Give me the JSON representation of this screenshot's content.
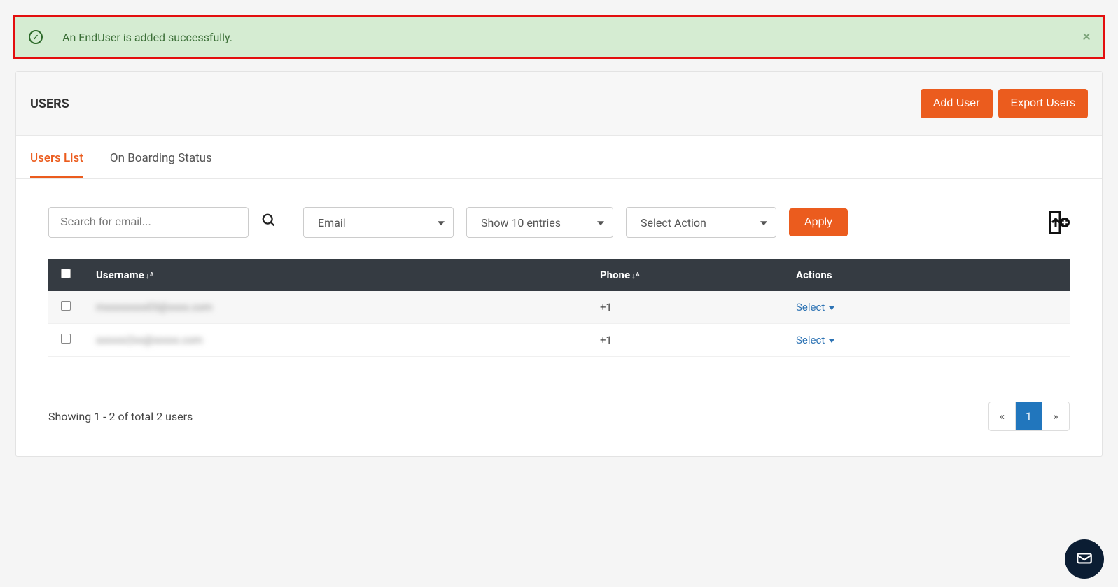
{
  "alert": {
    "message": "An EndUser is added successfully.",
    "close_symbol": "×"
  },
  "header": {
    "title": "USERS",
    "add_user_label": "Add User",
    "export_users_label": "Export Users"
  },
  "tabs": [
    {
      "label": "Users List",
      "active": true
    },
    {
      "label": "On Boarding Status",
      "active": false
    }
  ],
  "filters": {
    "search_placeholder": "Search for email...",
    "select_field": "Email",
    "entries": "Show 10 entries",
    "action": "Select Action",
    "apply_label": "Apply"
  },
  "table": {
    "columns": {
      "username": "Username",
      "phone": "Phone",
      "actions": "Actions"
    },
    "sort_symbol": "↓A͏Z",
    "rows": [
      {
        "username": "mxxxxxxxx03@xxxx.com",
        "phone": "+1",
        "action_label": "Select"
      },
      {
        "username": "sxxxxx2xx@xxxxx.com",
        "phone": "+1",
        "action_label": "Select"
      }
    ]
  },
  "footer": {
    "results_text": "Showing 1 - 2 of total 2 users",
    "prev_symbol": "«",
    "next_symbol": "»",
    "pages": [
      "1"
    ]
  }
}
